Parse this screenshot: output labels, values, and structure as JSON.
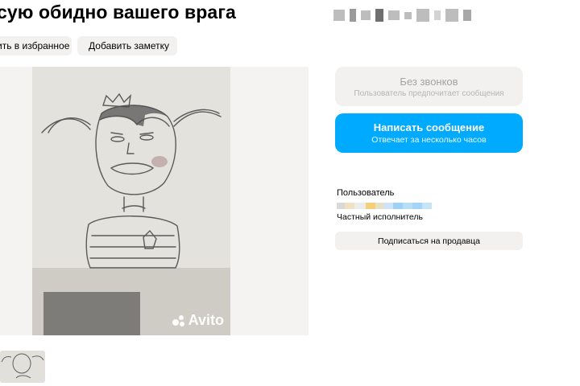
{
  "listing": {
    "title": "сую обидно вашего врага",
    "watermark": "Avito"
  },
  "actions": {
    "favorite_label": "ить в избранное",
    "note_label": "Добавить заметку"
  },
  "contact": {
    "calls_title": "Без звонков",
    "calls_subtitle": "Пользователь предпочитает сообщения",
    "message_title": "Написать сообщение",
    "message_subtitle": "Отвечает за несколько часов"
  },
  "seller": {
    "label": "Пользователь",
    "type": "Частный исполнитель",
    "subscribe_label": "Подписаться на продавца"
  },
  "colors": {
    "accent": "#00aaff",
    "chip_bg": "#f2f1f0"
  }
}
